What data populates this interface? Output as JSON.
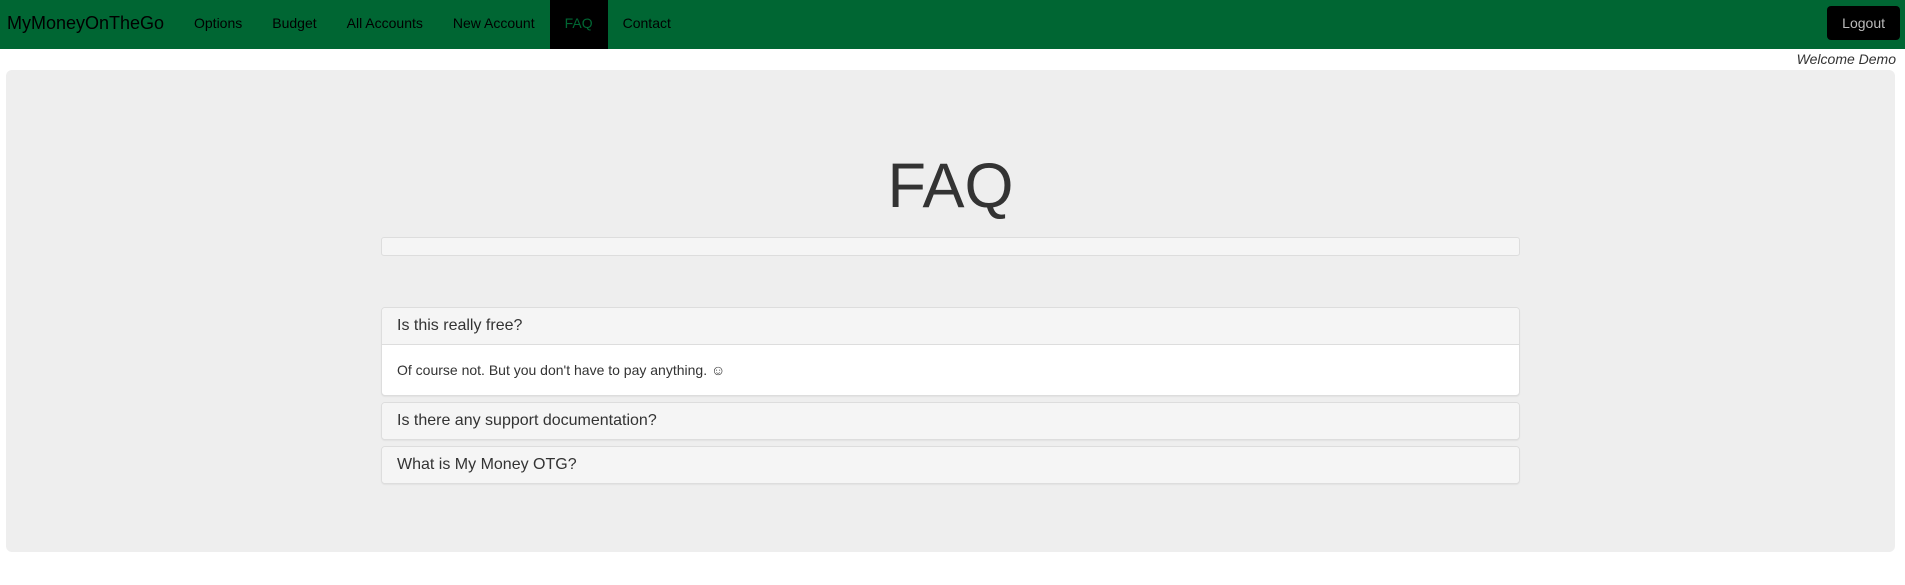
{
  "nav": {
    "brand": "MyMoneyOnTheGo",
    "items": [
      {
        "label": "Options"
      },
      {
        "label": "Budget"
      },
      {
        "label": "All Accounts"
      },
      {
        "label": "New Account"
      },
      {
        "label": "FAQ",
        "active": true
      },
      {
        "label": "Contact"
      }
    ],
    "logout_label": "Logout"
  },
  "welcome_text": "Welcome Demo",
  "page": {
    "title": "FAQ"
  },
  "faq": [
    {
      "question": "Is this really free?",
      "answer": "Of course not. But you don't have to pay anything. ☺",
      "expanded": true
    },
    {
      "question": "Is there any support documentation?",
      "expanded": false
    },
    {
      "question": "What is My Money OTG?",
      "expanded": false
    }
  ],
  "colors": {
    "navbar": "#006633",
    "jumbotron": "#eeeeee",
    "panel_heading": "#f5f5f5"
  }
}
